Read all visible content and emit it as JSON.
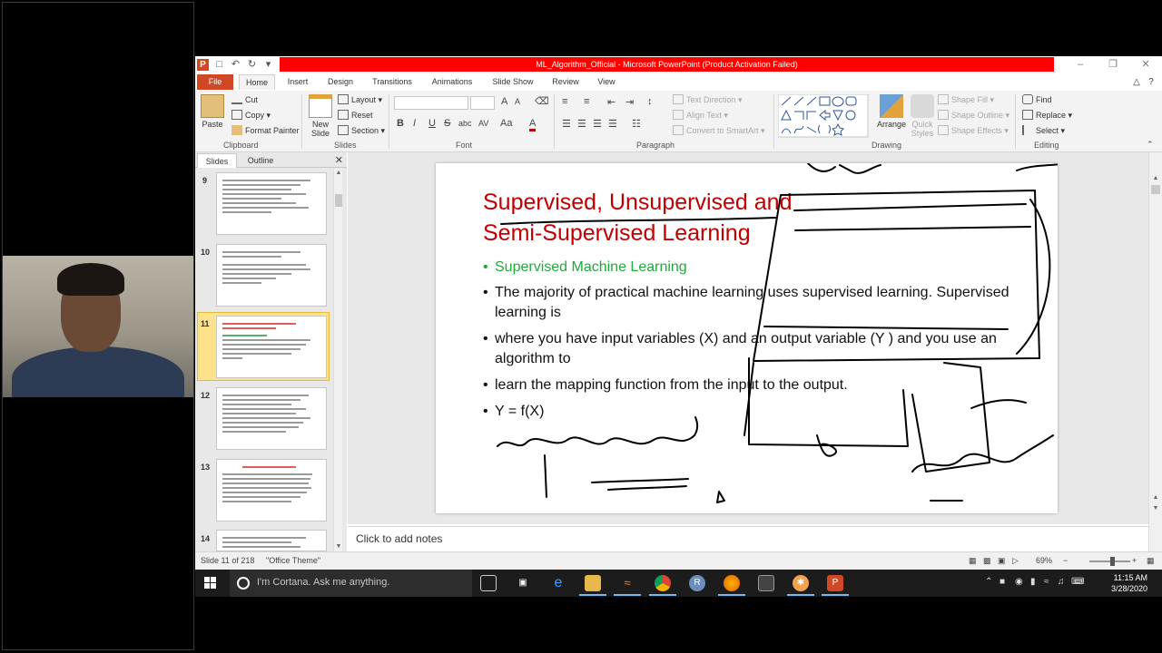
{
  "window": {
    "title": "ML_Algorithm_Official - Microsoft PowerPoint (Product Activation Failed)",
    "qat_icons": [
      "powerpoint-logo",
      "save-icon",
      "undo-icon",
      "redo-icon",
      "customize-icon"
    ]
  },
  "tabs": [
    "File",
    "Home",
    "Insert",
    "Design",
    "Transitions",
    "Animations",
    "Slide Show",
    "Review",
    "View"
  ],
  "active_tab": "Home",
  "ribbon": {
    "clipboard": {
      "paste": "Paste",
      "cut": "Cut",
      "copy": "Copy",
      "format_painter": "Format Painter",
      "label": "Clipboard"
    },
    "slides": {
      "new_slide": "New Slide",
      "layout": "Layout",
      "reset": "Reset",
      "section": "Section",
      "label": "Slides"
    },
    "font": {
      "label": "Font",
      "bold": "B",
      "italic": "I",
      "underline": "U",
      "strike": "S",
      "shadow": "abc",
      "spacing": "AV",
      "case": "Aa",
      "color": "A"
    },
    "paragraph": {
      "text_direction": "Text Direction",
      "align_text": "Align Text",
      "convert_smartart": "Convert to SmartArt",
      "label": "Paragraph"
    },
    "drawing": {
      "arrange": "Arrange",
      "quick_styles": "Quick Styles",
      "shape_fill": "Shape Fill",
      "shape_outline": "Shape Outline",
      "shape_effects": "Shape Effects",
      "label": "Drawing"
    },
    "editing": {
      "find": "Find",
      "replace": "Replace",
      "select": "Select",
      "label": "Editing"
    }
  },
  "panel": {
    "tabs": [
      "Slides",
      "Outline"
    ],
    "thumbnails": [
      {
        "num": "9"
      },
      {
        "num": "10"
      },
      {
        "num": "11",
        "selected": true
      },
      {
        "num": "12"
      },
      {
        "num": "13"
      },
      {
        "num": "14"
      }
    ]
  },
  "slide": {
    "title": "Supervised, Unsupervised and Semi-Supervised Learning",
    "bullets": [
      "Supervised Machine Learning",
      "The majority of practical machine learning uses supervised learning. Supervised learning is",
      "where you have input variables (X) and an output variable (Y ) and you use an algorithm to",
      "learn the mapping function from the input to the output.",
      "Y = f(X)"
    ],
    "accent_title": "#c00000",
    "accent_green": "#1faa3a"
  },
  "notes": {
    "placeholder": "Click to add notes"
  },
  "status": {
    "slide_info": "Slide 11 of 218",
    "theme": "\"Office Theme\"",
    "zoom": "69%"
  },
  "taskbar": {
    "search_placeholder": "I'm Cortana. Ask me anything.",
    "time": "11:15 AM",
    "date": "3/28/2020"
  }
}
